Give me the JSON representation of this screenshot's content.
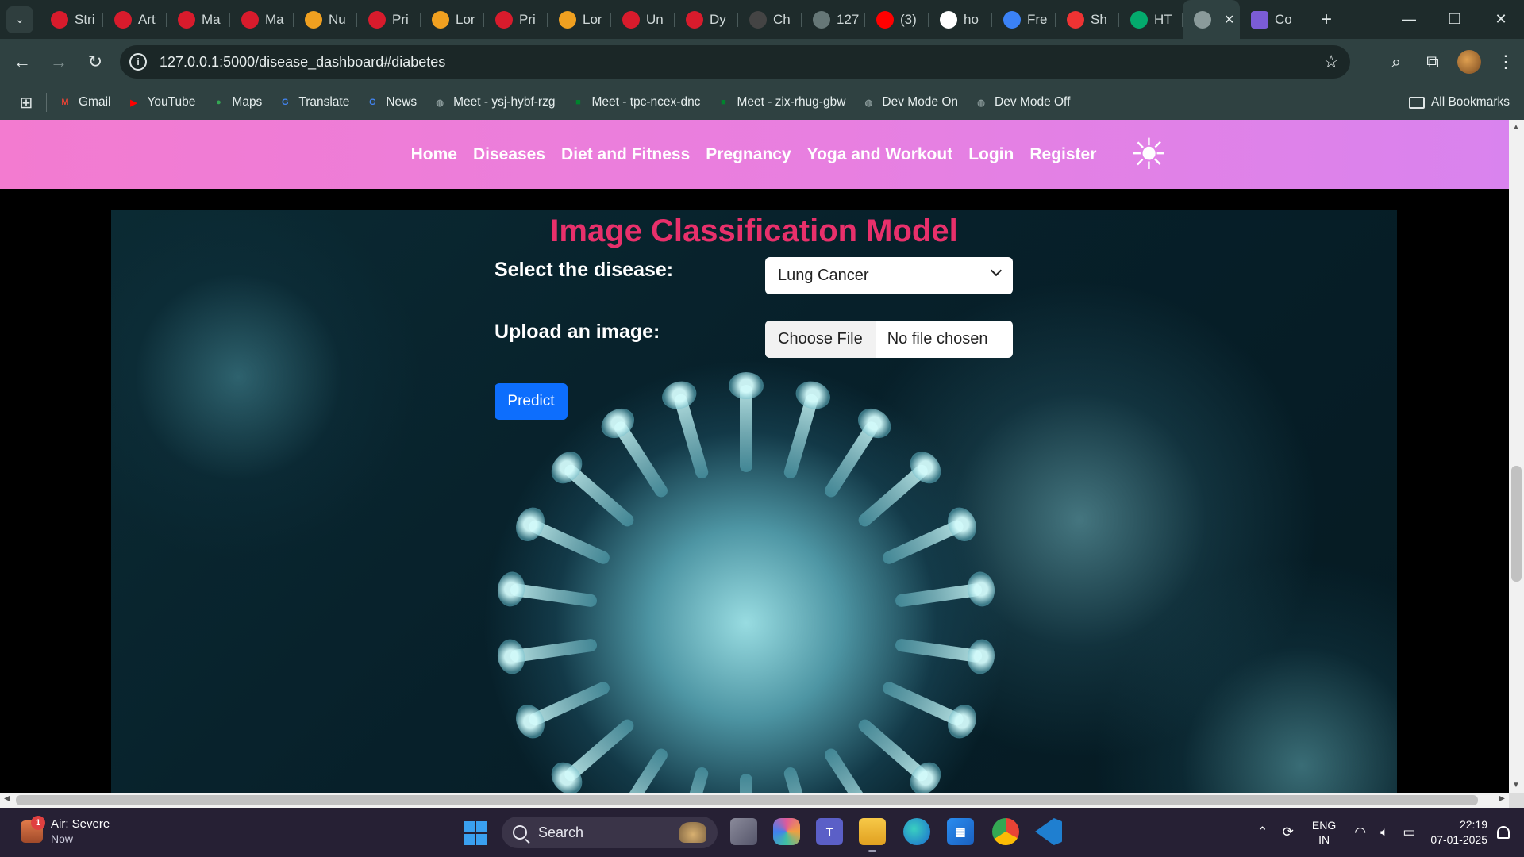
{
  "browser": {
    "tabs": [
      {
        "title": "Stri",
        "icon": "tuf-icon",
        "color": "#d81b2c"
      },
      {
        "title": "Art",
        "icon": "tuf-icon",
        "color": "#d81b2c"
      },
      {
        "title": "Ma",
        "icon": "tuf-icon",
        "color": "#d81b2c"
      },
      {
        "title": "Ma",
        "icon": "tuf-icon",
        "color": "#d81b2c"
      },
      {
        "title": "Nu",
        "icon": "leetcode-icon",
        "color": "#f0a020"
      },
      {
        "title": "Pri",
        "icon": "tuf-icon",
        "color": "#d81b2c"
      },
      {
        "title": "Lor",
        "icon": "leetcode-icon",
        "color": "#f0a020"
      },
      {
        "title": "Pri",
        "icon": "tuf-icon",
        "color": "#d81b2c"
      },
      {
        "title": "Lor",
        "icon": "leetcode-icon",
        "color": "#f0a020"
      },
      {
        "title": "Un",
        "icon": "tuf-icon",
        "color": "#d81b2c"
      },
      {
        "title": "Dy",
        "icon": "tuf-icon",
        "color": "#d81b2c"
      },
      {
        "title": "Ch",
        "icon": "chatgpt-icon",
        "color": "#444444"
      },
      {
        "title": "127",
        "icon": "globe-icon",
        "color": "#667777"
      },
      {
        "title": "(3)",
        "icon": "youtube-icon",
        "color": "#ff0000"
      },
      {
        "title": "ho",
        "icon": "google-icon",
        "color": "#ffffff"
      },
      {
        "title": "Fre",
        "icon": "gemini-icon",
        "color": "#3b82f6"
      },
      {
        "title": "Sh",
        "icon": "screen-icon",
        "color": "#ee3333"
      },
      {
        "title": "HT",
        "icon": "w3-icon",
        "color": "#04aa6d"
      }
    ],
    "active_tab": {
      "icon": "globe-icon",
      "close": "✕"
    },
    "last_tab": {
      "title": "Co",
      "icon": "docs-icon",
      "color": "#7b5cd6"
    },
    "new_tab": "+",
    "window": {
      "minimize": "—",
      "restore": "❐",
      "close": "✕"
    },
    "url": "127.0.0.1:5000/disease_dashboard#diabetes",
    "bookmarks": [
      {
        "label": "Gmail",
        "icon": "gmail-icon",
        "glyph": "M",
        "color": "#ea4335"
      },
      {
        "label": "YouTube",
        "icon": "youtube-icon",
        "glyph": "▶",
        "color": "#ff0000"
      },
      {
        "label": "Maps",
        "icon": "maps-icon",
        "glyph": "●",
        "color": "#34a853"
      },
      {
        "label": "Translate",
        "icon": "translate-icon",
        "glyph": "G",
        "color": "#4285f4"
      },
      {
        "label": "News",
        "icon": "news-icon",
        "glyph": "G",
        "color": "#4285f4"
      },
      {
        "label": "Meet - ysj-hybf-rzg",
        "icon": "globe-icon",
        "glyph": "◍",
        "color": "#8a9a9a"
      },
      {
        "label": "Meet - tpc-ncex-dnc",
        "icon": "meet-icon",
        "glyph": "■",
        "color": "#00832d"
      },
      {
        "label": "Meet - zix-rhug-gbw",
        "icon": "meet-icon",
        "glyph": "■",
        "color": "#00832d"
      },
      {
        "label": "Dev Mode On",
        "icon": "globe-icon",
        "glyph": "◍",
        "color": "#8a9a9a"
      },
      {
        "label": "Dev Mode Off",
        "icon": "globe-icon",
        "glyph": "◍",
        "color": "#8a9a9a"
      }
    ],
    "all_bookmarks": "All Bookmarks"
  },
  "site": {
    "nav": [
      "Home",
      "Diseases",
      "Diet and Fitness",
      "Pregnancy",
      "Yoga and Workout",
      "Login",
      "Register"
    ],
    "theme_icon": "sun-icon",
    "form": {
      "title": "Image Classification Model",
      "select_label": "Select the disease:",
      "selected_disease": "Lung Cancer",
      "upload_label": "Upload an image:",
      "choose_file": "Choose File",
      "no_file": "No file chosen",
      "predict": "Predict"
    }
  },
  "taskbar": {
    "weather_title": "Air: Severe",
    "weather_sub": "Now",
    "weather_badge": "1",
    "search": "Search",
    "lang_line1": "ENG",
    "lang_line2": "IN",
    "time": "22:19",
    "date": "07-01-2025"
  }
}
